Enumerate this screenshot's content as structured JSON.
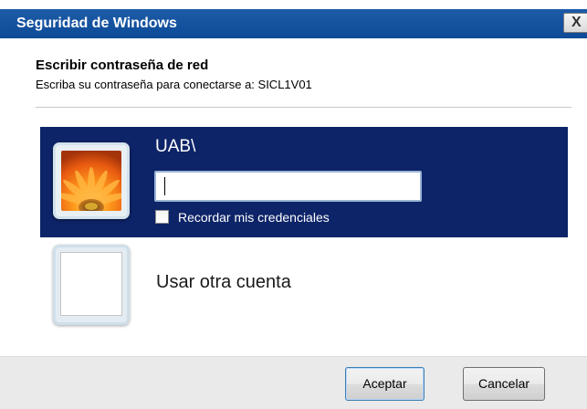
{
  "window": {
    "title": "Seguridad de Windows",
    "close_label": "X"
  },
  "dialog": {
    "heading": "Escribir contraseña de red",
    "subheading": "Escriba su contraseña para conectarse a: SICL1V01"
  },
  "account": {
    "domain_label": "UAB\\",
    "password_value": "",
    "password_placeholder": "",
    "remember_label": "Recordar mis credenciales",
    "remember_checked": false,
    "avatar_icon": "flower-avatar-icon",
    "tile_color": "#0d2468"
  },
  "other_account": {
    "label": "Usar otra cuenta",
    "avatar_icon": "blank-avatar-icon"
  },
  "buttons": {
    "ok_label": "Aceptar",
    "cancel_label": "Cancelar"
  },
  "colors": {
    "titlebar": "#0d4a97",
    "selected_tile": "#0d2468",
    "footer": "#eaeaea"
  }
}
